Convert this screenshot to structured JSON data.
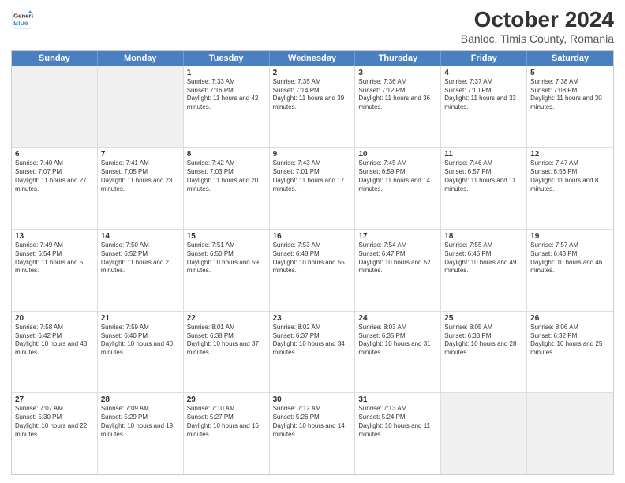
{
  "header": {
    "logo_line1": "General",
    "logo_line2": "Blue",
    "title": "October 2024",
    "subtitle": "Banloc, Timis County, Romania"
  },
  "days_of_week": [
    "Sunday",
    "Monday",
    "Tuesday",
    "Wednesday",
    "Thursday",
    "Friday",
    "Saturday"
  ],
  "weeks": [
    [
      {
        "day": "",
        "info": ""
      },
      {
        "day": "",
        "info": ""
      },
      {
        "day": "1",
        "info": "Sunrise: 7:33 AM\nSunset: 7:16 PM\nDaylight: 11 hours and 42 minutes."
      },
      {
        "day": "2",
        "info": "Sunrise: 7:35 AM\nSunset: 7:14 PM\nDaylight: 11 hours and 39 minutes."
      },
      {
        "day": "3",
        "info": "Sunrise: 7:36 AM\nSunset: 7:12 PM\nDaylight: 11 hours and 36 minutes."
      },
      {
        "day": "4",
        "info": "Sunrise: 7:37 AM\nSunset: 7:10 PM\nDaylight: 11 hours and 33 minutes."
      },
      {
        "day": "5",
        "info": "Sunrise: 7:38 AM\nSunset: 7:08 PM\nDaylight: 11 hours and 30 minutes."
      }
    ],
    [
      {
        "day": "6",
        "info": "Sunrise: 7:40 AM\nSunset: 7:07 PM\nDaylight: 11 hours and 27 minutes."
      },
      {
        "day": "7",
        "info": "Sunrise: 7:41 AM\nSunset: 7:05 PM\nDaylight: 11 hours and 23 minutes."
      },
      {
        "day": "8",
        "info": "Sunrise: 7:42 AM\nSunset: 7:03 PM\nDaylight: 11 hours and 20 minutes."
      },
      {
        "day": "9",
        "info": "Sunrise: 7:43 AM\nSunset: 7:01 PM\nDaylight: 11 hours and 17 minutes."
      },
      {
        "day": "10",
        "info": "Sunrise: 7:45 AM\nSunset: 6:59 PM\nDaylight: 11 hours and 14 minutes."
      },
      {
        "day": "11",
        "info": "Sunrise: 7:46 AM\nSunset: 6:57 PM\nDaylight: 11 hours and 11 minutes."
      },
      {
        "day": "12",
        "info": "Sunrise: 7:47 AM\nSunset: 6:56 PM\nDaylight: 11 hours and 8 minutes."
      }
    ],
    [
      {
        "day": "13",
        "info": "Sunrise: 7:49 AM\nSunset: 6:54 PM\nDaylight: 11 hours and 5 minutes."
      },
      {
        "day": "14",
        "info": "Sunrise: 7:50 AM\nSunset: 6:52 PM\nDaylight: 11 hours and 2 minutes."
      },
      {
        "day": "15",
        "info": "Sunrise: 7:51 AM\nSunset: 6:50 PM\nDaylight: 10 hours and 59 minutes."
      },
      {
        "day": "16",
        "info": "Sunrise: 7:53 AM\nSunset: 6:48 PM\nDaylight: 10 hours and 55 minutes."
      },
      {
        "day": "17",
        "info": "Sunrise: 7:54 AM\nSunset: 6:47 PM\nDaylight: 10 hours and 52 minutes."
      },
      {
        "day": "18",
        "info": "Sunrise: 7:55 AM\nSunset: 6:45 PM\nDaylight: 10 hours and 49 minutes."
      },
      {
        "day": "19",
        "info": "Sunrise: 7:57 AM\nSunset: 6:43 PM\nDaylight: 10 hours and 46 minutes."
      }
    ],
    [
      {
        "day": "20",
        "info": "Sunrise: 7:58 AM\nSunset: 6:42 PM\nDaylight: 10 hours and 43 minutes."
      },
      {
        "day": "21",
        "info": "Sunrise: 7:59 AM\nSunset: 6:40 PM\nDaylight: 10 hours and 40 minutes."
      },
      {
        "day": "22",
        "info": "Sunrise: 8:01 AM\nSunset: 6:38 PM\nDaylight: 10 hours and 37 minutes."
      },
      {
        "day": "23",
        "info": "Sunrise: 8:02 AM\nSunset: 6:37 PM\nDaylight: 10 hours and 34 minutes."
      },
      {
        "day": "24",
        "info": "Sunrise: 8:03 AM\nSunset: 6:35 PM\nDaylight: 10 hours and 31 minutes."
      },
      {
        "day": "25",
        "info": "Sunrise: 8:05 AM\nSunset: 6:33 PM\nDaylight: 10 hours and 28 minutes."
      },
      {
        "day": "26",
        "info": "Sunrise: 8:06 AM\nSunset: 6:32 PM\nDaylight: 10 hours and 25 minutes."
      }
    ],
    [
      {
        "day": "27",
        "info": "Sunrise: 7:07 AM\nSunset: 5:30 PM\nDaylight: 10 hours and 22 minutes."
      },
      {
        "day": "28",
        "info": "Sunrise: 7:09 AM\nSunset: 5:29 PM\nDaylight: 10 hours and 19 minutes."
      },
      {
        "day": "29",
        "info": "Sunrise: 7:10 AM\nSunset: 5:27 PM\nDaylight: 10 hours and 16 minutes."
      },
      {
        "day": "30",
        "info": "Sunrise: 7:12 AM\nSunset: 5:26 PM\nDaylight: 10 hours and 14 minutes."
      },
      {
        "day": "31",
        "info": "Sunrise: 7:13 AM\nSunset: 5:24 PM\nDaylight: 10 hours and 11 minutes."
      },
      {
        "day": "",
        "info": ""
      },
      {
        "day": "",
        "info": ""
      }
    ]
  ]
}
